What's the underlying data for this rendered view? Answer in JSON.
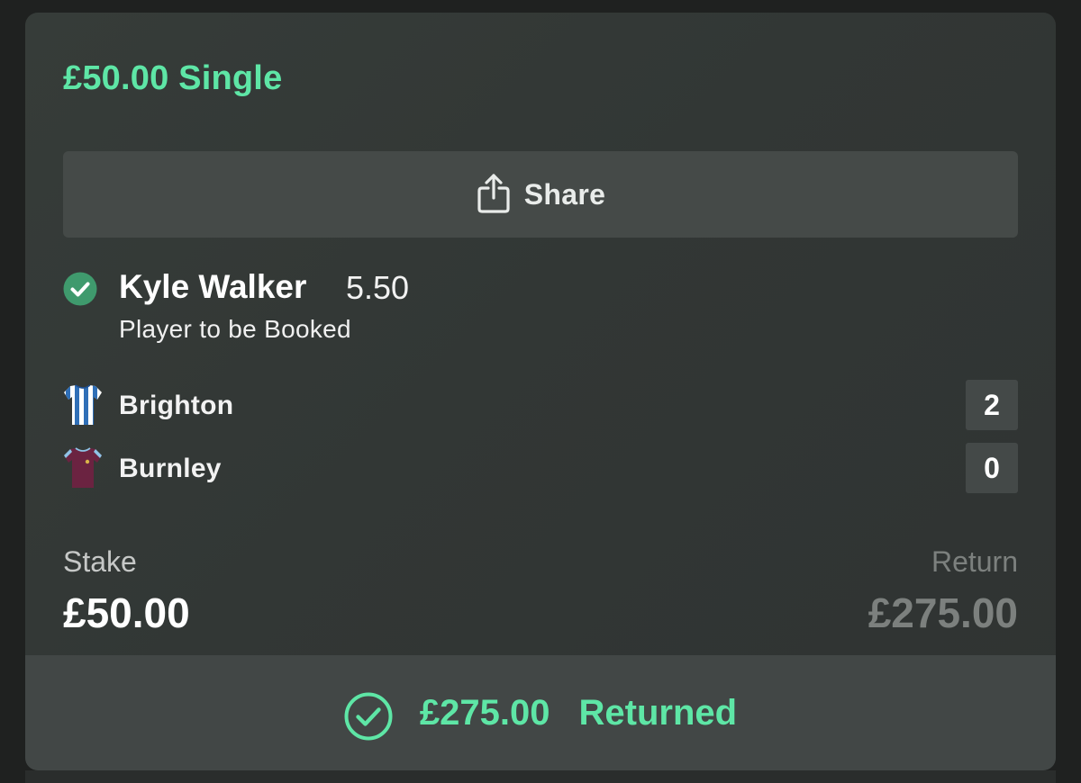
{
  "bet": {
    "title": "£50.00 Single",
    "share_label": "Share",
    "selection": {
      "player": "Kyle Walker",
      "odds": "5.50",
      "market": "Player to be Booked",
      "status_icon": "check-circle-icon"
    },
    "teams": [
      {
        "name": "Brighton",
        "score": "2",
        "shirt_icon": "brighton-shirt-icon"
      },
      {
        "name": "Burnley",
        "score": "0",
        "shirt_icon": "burnley-shirt-icon"
      }
    ],
    "stake_label": "Stake",
    "stake_value": "£50.00",
    "return_label": "Return",
    "return_value": "£275.00",
    "result": {
      "amount": "£275.00",
      "status": "Returned",
      "icon": "check-circle-icon"
    }
  },
  "colors": {
    "accent_green": "#5ee6a6",
    "check_green": "#3f9a6d",
    "card_bg": "#343936",
    "button_bg": "#454a48",
    "muted_text": "#7c807e"
  }
}
